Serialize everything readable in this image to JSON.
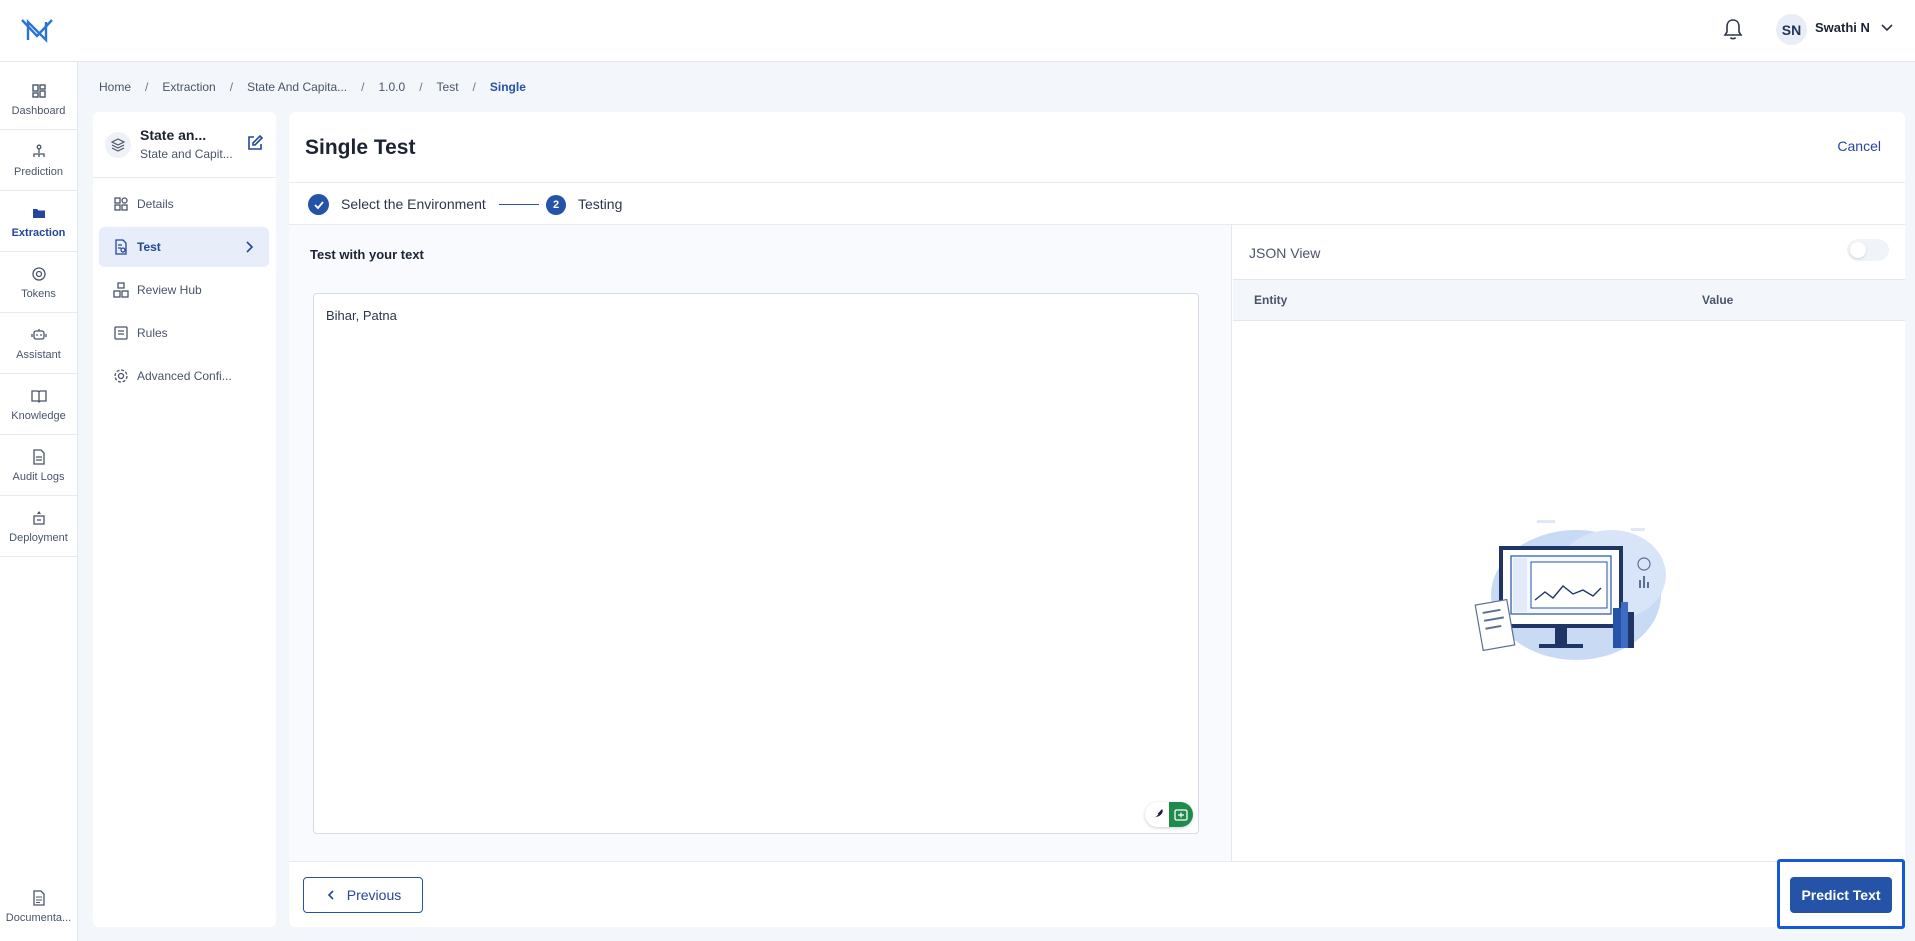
{
  "header": {
    "logo_name": "app-logo",
    "user_initials": "SN",
    "user_name": "Swathi N"
  },
  "rail": {
    "items": [
      {
        "label": "Dashboard",
        "icon": "dashboard-icon"
      },
      {
        "label": "Prediction",
        "icon": "prediction-icon"
      },
      {
        "label": "Extraction",
        "icon": "folder-icon",
        "active": true
      },
      {
        "label": "Tokens",
        "icon": "tokens-icon"
      },
      {
        "label": "Assistant",
        "icon": "assistant-icon"
      },
      {
        "label": "Knowledge",
        "icon": "book-icon"
      },
      {
        "label": "Audit Logs",
        "icon": "document-icon"
      },
      {
        "label": "Deployment",
        "icon": "deployment-icon"
      }
    ],
    "doc_label": "Documenta..."
  },
  "breadcrumb": {
    "items": [
      "Home",
      "Extraction",
      "State And Capita...",
      "1.0.0",
      "Test"
    ],
    "current": "Single"
  },
  "subnav": {
    "project_title": "State an...",
    "project_subtitle": "State and Capit...",
    "items": [
      {
        "label": "Details",
        "icon": "details-icon"
      },
      {
        "label": "Test",
        "icon": "test-icon",
        "active": true
      },
      {
        "label": "Review Hub",
        "icon": "review-hub-icon"
      },
      {
        "label": "Rules",
        "icon": "rules-icon"
      },
      {
        "label": "Advanced Confi...",
        "icon": "gear-icon"
      }
    ]
  },
  "main": {
    "title": "Single Test",
    "cancel_label": "Cancel",
    "step1_label": "Select the Environment",
    "step2_number": "2",
    "step2_label": "Testing",
    "input_label": "Test with your text",
    "input_value": "Bihar, Patna",
    "json_view_label": "JSON View",
    "json_view_on": false,
    "col_entity": "Entity",
    "col_value": "Value",
    "previous_label": "Previous",
    "predict_label": "Predict Text"
  },
  "colors": {
    "accent": "#2453a8",
    "highlight_border": "#1559d6",
    "grammar_badge": "#1e8a4c"
  }
}
